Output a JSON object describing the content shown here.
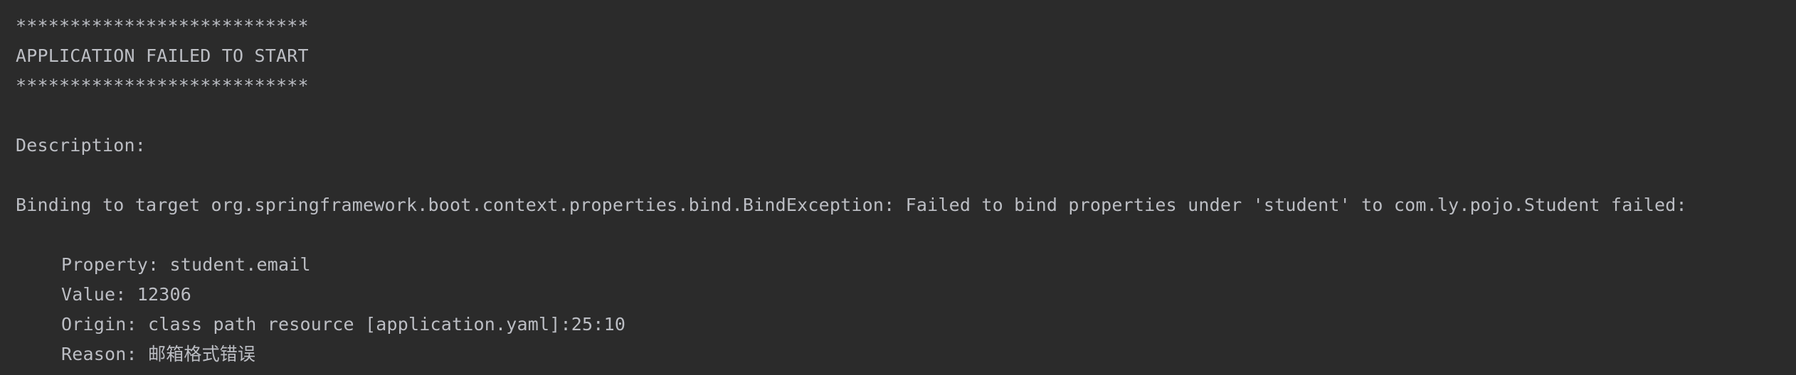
{
  "console": {
    "stars_top": "***************************",
    "title": "APPLICATION FAILED TO START",
    "stars_bottom": "***************************",
    "description_label": "Description:",
    "binding_message": "Binding to target org.springframework.boot.context.properties.bind.BindException: Failed to bind properties under 'student' to com.ly.pojo.Student failed:",
    "property": "Property: student.email",
    "value": "Value: 12306",
    "origin": "Origin: class path resource [application.yaml]:25:10",
    "reason": "Reason: 邮箱格式错误"
  },
  "colors": {
    "background": "#2b2b2b",
    "text": "#bcbec4"
  }
}
